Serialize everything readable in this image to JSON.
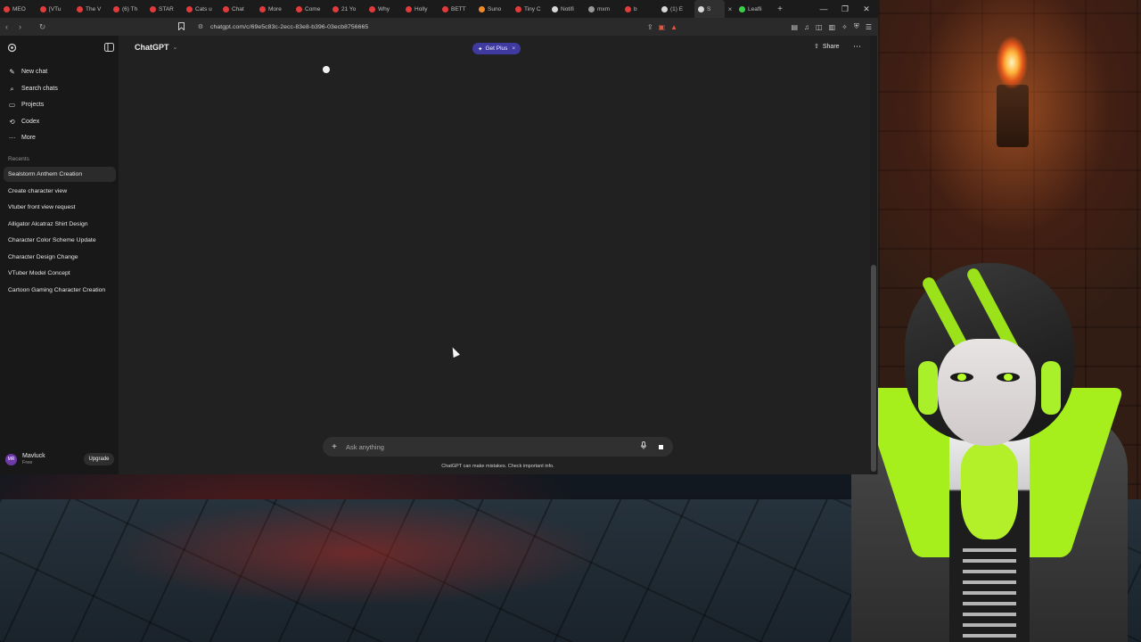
{
  "browser": {
    "tabs": [
      {
        "label": "MEO",
        "color": "#e23b3b"
      },
      {
        "label": "[VTu",
        "color": "#e23b3b"
      },
      {
        "label": "The V",
        "color": "#e23b3b"
      },
      {
        "label": "(6) Th",
        "color": "#e23b3b"
      },
      {
        "label": "STAR",
        "color": "#e23b3b"
      },
      {
        "label": "Cats u",
        "color": "#e23b3b"
      },
      {
        "label": "Chat",
        "color": "#e23b3b"
      },
      {
        "label": "More",
        "color": "#e23b3b"
      },
      {
        "label": "Come",
        "color": "#e23b3b"
      },
      {
        "label": "21 Yo",
        "color": "#e23b3b"
      },
      {
        "label": "Why",
        "color": "#e23b3b"
      },
      {
        "label": "Holly",
        "color": "#e23b3b"
      },
      {
        "label": "BETT",
        "color": "#e23b3b"
      },
      {
        "label": "Suno",
        "color": "#f08a2a"
      },
      {
        "label": "Tiny C",
        "color": "#e23b3b"
      },
      {
        "label": "Notifi",
        "color": "#d8d8d8"
      },
      {
        "label": "mxm",
        "color": "#9a9a9a"
      },
      {
        "label": "b",
        "color": "#e23b3b"
      },
      {
        "label": "(1) E",
        "color": "#d8d8d8"
      }
    ],
    "active_tab": {
      "label": "S",
      "close": "×"
    },
    "extra_tab": {
      "label": "Leafli",
      "color": "#3ad04a"
    },
    "new_tab": "+",
    "window_buttons": [
      "—",
      "❐",
      "✕"
    ],
    "nav": {
      "back": "‹",
      "forward": "›",
      "reload": "↻"
    },
    "bookmark_icon": "bookmark-icon",
    "url": "chatgpt.com/c/69e5c83c-2ecc-83e8-b396-03ecb8756665",
    "url_icons": {
      "share": "⇪",
      "shield": "▣",
      "alert": "▲"
    },
    "extensions": [
      "▤",
      "♫",
      "◫",
      "▥",
      "✧",
      "⛨",
      "☰"
    ]
  },
  "sidebar": {
    "logo_icon": "openai-logo-icon",
    "toggle_icon": "sidebar-toggle-icon",
    "items": [
      {
        "label": "New chat",
        "icon": "✎"
      },
      {
        "label": "Search chats",
        "icon": "⌕"
      },
      {
        "label": "Projects",
        "icon": "▭"
      },
      {
        "label": "Codex",
        "icon": "⟲"
      },
      {
        "label": "More",
        "icon": "⋯"
      }
    ],
    "recents_label": "Recents",
    "chats": [
      "Sealstorm Anthem Creation",
      "Create character view",
      "Vtuber front view request",
      "Alligator Alcatraz Shirt Design",
      "Character Color Scheme Update",
      "Character Design Change",
      "VTuber Model Concept",
      "Cartoon Gaming Character Creation"
    ],
    "user": {
      "initials": "MR",
      "name": "Mavluck",
      "plan": "Free",
      "upgrade": "Upgrade"
    }
  },
  "header": {
    "model": "ChatGPT",
    "chevron": "⌄",
    "get_plus": "Get Plus",
    "get_plus_icon": "✦",
    "get_plus_close": "×",
    "share": "Share",
    "share_icon": "⇧",
    "more": "⋯"
  },
  "composer": {
    "plus": "+",
    "placeholder": "Ask anything",
    "mic_icon": "🎙",
    "disclaimer": "ChatGPT can make mistakes. Check important info."
  },
  "colors": {
    "accent_purple": "#3f3aa0",
    "avatar_purple": "#6e3aa8",
    "vtuber_green": "#a6ee1c",
    "torch_orange": "#ffb23a"
  }
}
